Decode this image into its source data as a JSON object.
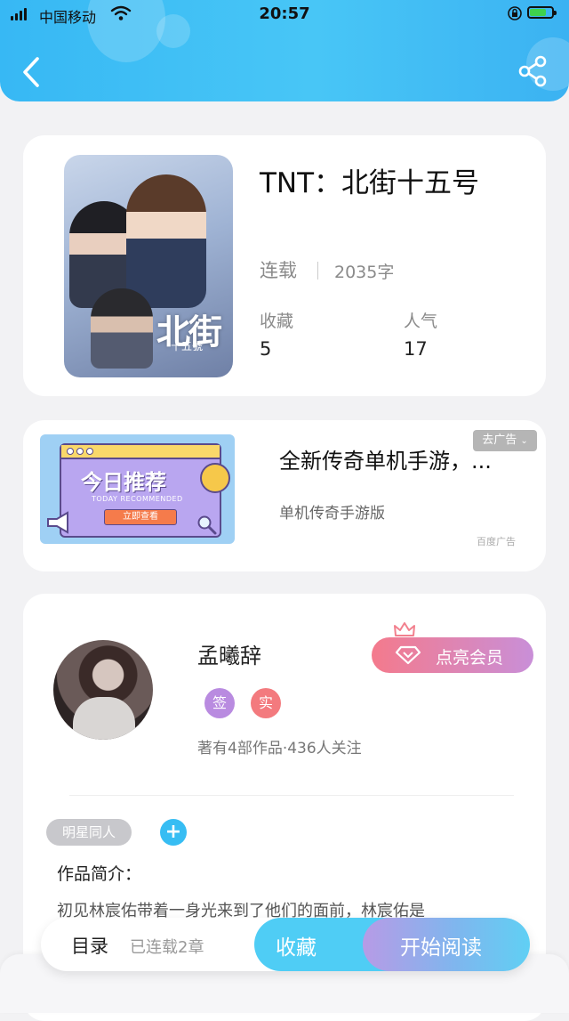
{
  "status_bar": {
    "carrier": "中国移动",
    "time": "20:57",
    "battery_level": 0.75
  },
  "book": {
    "title": "TNT：北街十五号",
    "status": "连载",
    "word_count": "2035字",
    "cover_title": "北街",
    "cover_subtitle": "十五號",
    "stats": [
      {
        "label": "收藏",
        "value": "5"
      },
      {
        "label": "人气",
        "value": "17"
      }
    ]
  },
  "ad": {
    "title": "全新传奇单机手游，...",
    "subtitle": "单机传奇手游版",
    "close_label": "去广告",
    "source": "百度广告",
    "image_headline": "今日推荐",
    "image_english": "TODAY RECOMMENDED",
    "image_cta": "立即查看"
  },
  "author": {
    "name": "孟曦辞",
    "member_button": "点亮会员",
    "badges": [
      {
        "label": "签",
        "color": "#b98be0"
      },
      {
        "label": "实",
        "color": "#f37a7e"
      }
    ],
    "works_summary": "著有4部作品·436人关注"
  },
  "tags": [
    "明星同人"
  ],
  "intro": {
    "title": "作品简介：",
    "text": "初见林宸佑带着一身光来到了他们的面前，林宸佑是"
  },
  "bottom_bar": {
    "toc_label": "目录",
    "chapters": "已连载2章",
    "collect_label": "收藏",
    "read_label": "开始阅读"
  },
  "colors": {
    "header_blue": "#3bb8f4",
    "collect_blue": "#4fcdf5",
    "member_pink": "#f47a8c"
  }
}
